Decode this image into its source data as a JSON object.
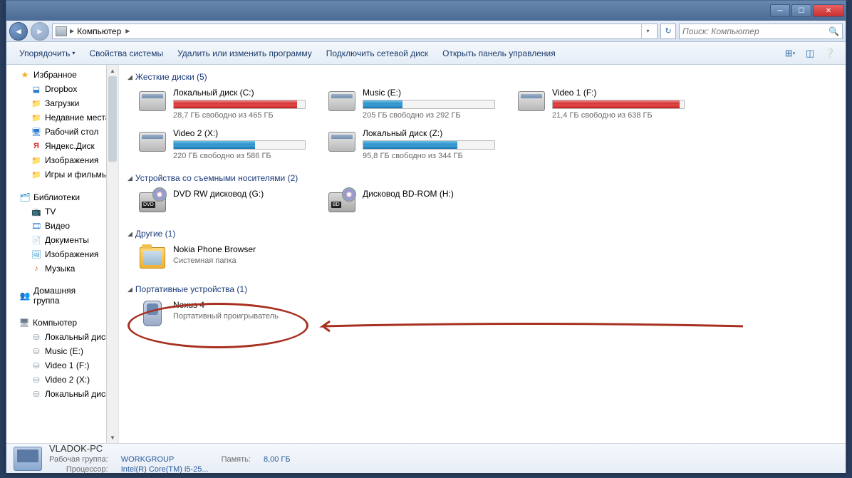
{
  "titlebar": {
    "min": "─",
    "max": "☐",
    "close": "✕"
  },
  "address": {
    "path": "Компьютер",
    "sep": "▶"
  },
  "search": {
    "placeholder": "Поиск: Компьютер"
  },
  "toolbar": {
    "organize": "Упорядочить",
    "props": "Свойства системы",
    "uninstall": "Удалить или изменить программу",
    "netdrive": "Подключить сетевой диск",
    "ctrlpanel": "Открыть панель управления"
  },
  "sidebar": {
    "favorites": {
      "label": "Избранное",
      "items": [
        "Dropbox",
        "Загрузки",
        "Недавние места",
        "Рабочий стол",
        "Яндекс.Диск",
        "Изображения",
        "Игры и фильмы"
      ]
    },
    "libraries": {
      "label": "Библиотеки",
      "items": [
        "TV",
        "Видео",
        "Документы",
        "Изображения",
        "Музыка"
      ]
    },
    "homegroup": {
      "label": "Домашняя группа"
    },
    "computer": {
      "label": "Компьютер",
      "items": [
        "Локальный диск",
        "Music (E:)",
        "Video 1 (F:)",
        "Video 2 (X:)",
        "Локальный диск"
      ]
    }
  },
  "categories": {
    "hdd": {
      "label": "Жесткие диски (5)",
      "drives": [
        {
          "name": "Локальный диск (C:)",
          "sub": "28,7 ГБ свободно из 465 ГБ",
          "pct": 94,
          "color": "red"
        },
        {
          "name": "Music (E:)",
          "sub": "205 ГБ свободно из 292 ГБ",
          "pct": 30,
          "color": "blue"
        },
        {
          "name": "Video 1 (F:)",
          "sub": "21,4 ГБ свободно из 638 ГБ",
          "pct": 97,
          "color": "red"
        },
        {
          "name": "Video 2 (X:)",
          "sub": "220 ГБ свободно из 586 ГБ",
          "pct": 62,
          "color": "blue"
        },
        {
          "name": "Локальный диск (Z:)",
          "sub": "95,8 ГБ свободно из 344 ГБ",
          "pct": 72,
          "color": "blue"
        }
      ]
    },
    "removable": {
      "label": "Устройства со съемными носителями (2)",
      "drives": [
        {
          "name": "DVD RW дисковод (G:)",
          "tag": "DVD"
        },
        {
          "name": "Дисковод BD-ROM (H:)",
          "tag": "BD"
        }
      ]
    },
    "other": {
      "label": "Другие (1)",
      "items": [
        {
          "name": "Nokia Phone Browser",
          "sub": "Системная папка"
        }
      ]
    },
    "portable": {
      "label": "Портативные устройства (1)",
      "items": [
        {
          "name": "Nexus 4",
          "sub": "Портативный проигрыватель"
        }
      ]
    }
  },
  "status": {
    "pc": "VLADOK-PC",
    "wg_label": "Рабочая группа:",
    "wg": "WORKGROUP",
    "cpu_label": "Процессор:",
    "cpu": "Intel(R) Core(TM) i5-25...",
    "mem_label": "Память:",
    "mem": "8,00 ГБ"
  }
}
